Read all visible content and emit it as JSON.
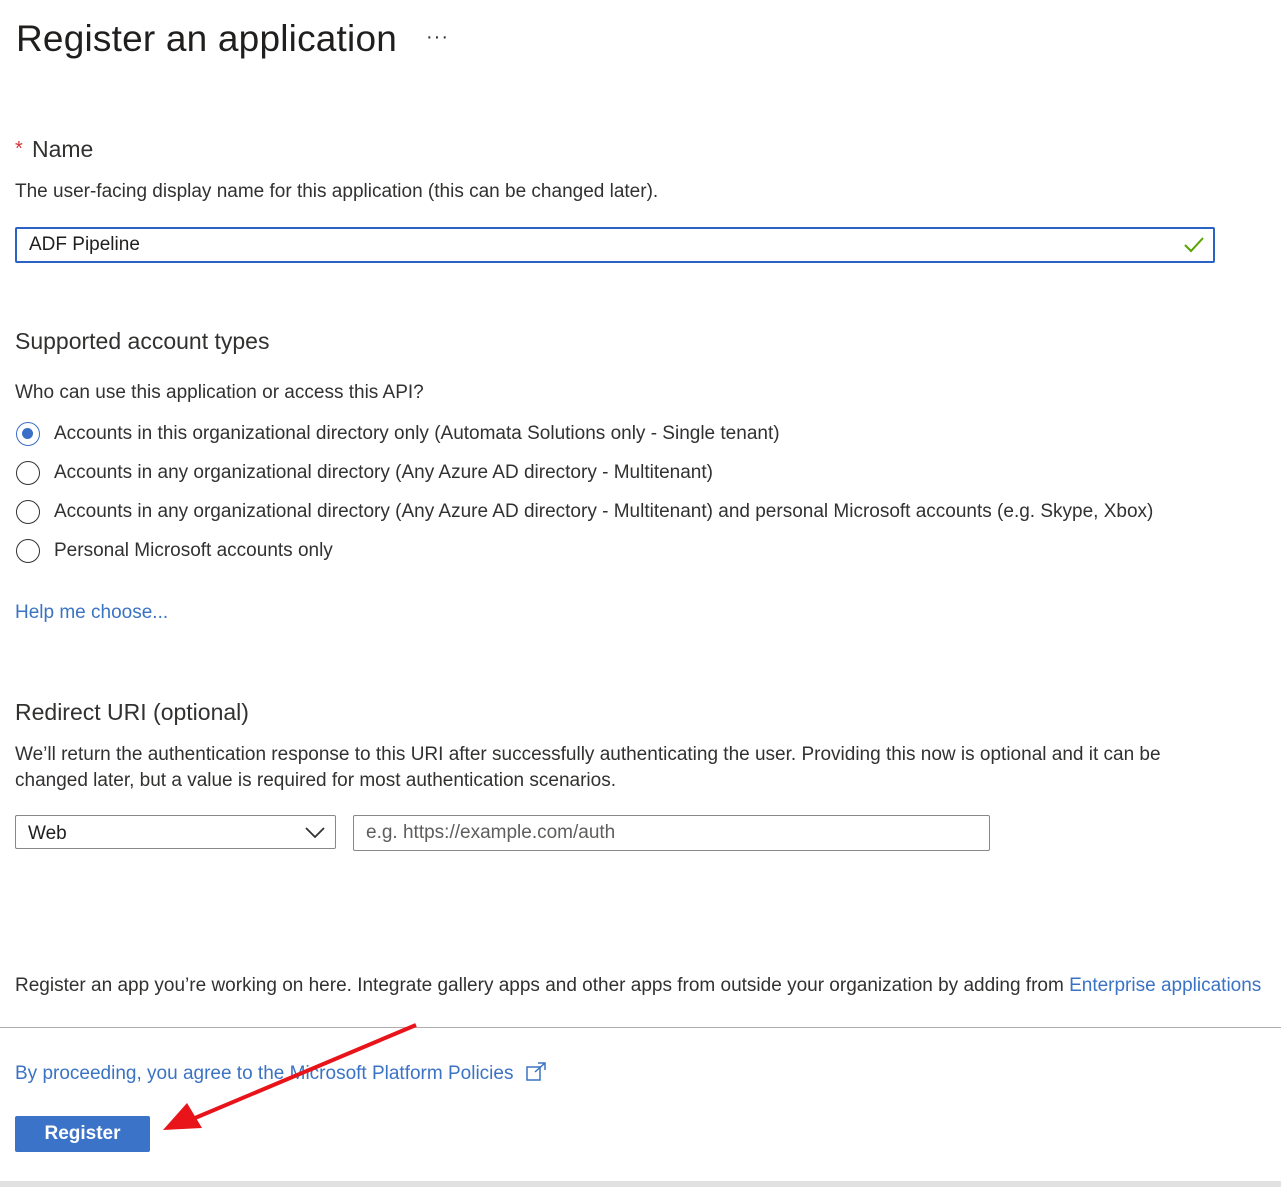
{
  "page": {
    "title": "Register an application",
    "more_label": "···"
  },
  "name_section": {
    "required_marker": "*",
    "heading": "Name",
    "description": "The user-facing display name for this application (this can be changed later).",
    "value": "ADF Pipeline",
    "valid_icon": "checkmark-icon"
  },
  "account_types": {
    "heading": "Supported account types",
    "question": "Who can use this application or access this API?",
    "options": [
      {
        "label": "Accounts in this organizational directory only (Automata Solutions only - Single tenant)",
        "selected": true
      },
      {
        "label": "Accounts in any organizational directory (Any Azure AD directory - Multitenant)",
        "selected": false
      },
      {
        "label": "Accounts in any organizational directory (Any Azure AD directory - Multitenant) and personal Microsoft accounts (e.g. Skype, Xbox)",
        "selected": false
      },
      {
        "label": "Personal Microsoft accounts only",
        "selected": false
      }
    ],
    "help_link": "Help me choose..."
  },
  "redirect": {
    "heading": "Redirect URI (optional)",
    "description_line1": "We’ll return the authentication response to this URI after successfully authenticating the user. Providing this now is optional and it can be",
    "description_line2": "changed later, but a value is required for most authentication scenarios.",
    "platform_value": "Web",
    "uri_value": "",
    "uri_placeholder": "e.g. https://example.com/auth"
  },
  "footer": {
    "note_prefix": "Register an app you’re working on here. Integrate gallery apps and other apps from outside your organization by adding from ",
    "note_link": "Enterprise applications",
    "policy_link": "By proceeding, you agree to the Microsoft Platform Policies",
    "policy_icon": "external-link-icon",
    "register_label": "Register"
  },
  "colors": {
    "accent": "#3b73c9",
    "link": "#3b73c4",
    "required": "#d13438",
    "valid": "#57a300",
    "annotation_arrow": "#e8141a"
  }
}
